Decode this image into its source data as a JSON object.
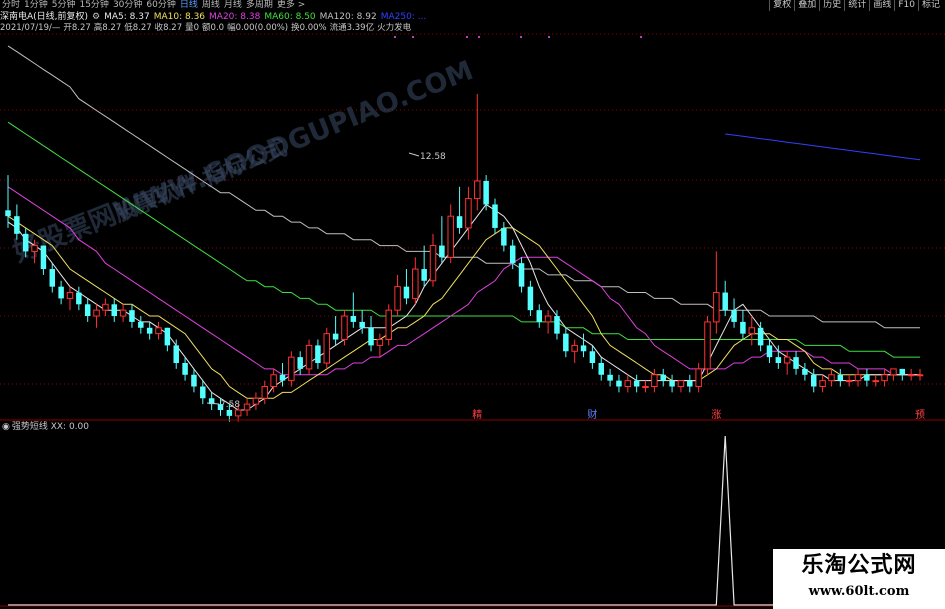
{
  "toolbar": {
    "periods": [
      "分时",
      "1分钟",
      "5分钟",
      "15分钟",
      "30分钟",
      "60分钟",
      "日线",
      "周线",
      "月线",
      "多周期",
      "更多 >"
    ],
    "active_period": "日线",
    "tools": [
      "复权",
      "叠加",
      "历史",
      "统计",
      "画线",
      "F10",
      "标记"
    ]
  },
  "stock": {
    "title": "深南电A(日线,前复权)",
    "ma": [
      {
        "label": "MA5: 8.37",
        "color": "#e8e8e8"
      },
      {
        "label": "MA10: 8.36",
        "color": "#f0e060"
      },
      {
        "label": "MA20: 8.38",
        "color": "#e040e0"
      },
      {
        "label": "MA60: 8.50",
        "color": "#40e040"
      },
      {
        "label": "MA120: 8.92",
        "color": "#c0c0c0"
      },
      {
        "label": "MA250: ...",
        "color": "#3040ff"
      }
    ],
    "ohlc": [
      "2021/07/19/—",
      "开8.27",
      "高8.27",
      "低8.27",
      "收8.27",
      "量0",
      "额0.0",
      "幅0.00(0.00%)",
      "换0.00%",
      "流通3.39亿",
      "火力发电"
    ]
  },
  "watermark": {
    "site": "好股票网WWW.GOODGUPIAO.COM",
    "tagline": "股票软件 指标公式"
  },
  "signals": [
    {
      "text": "精",
      "color": "#ff4040"
    },
    {
      "text": "财",
      "color": "#6080ff"
    },
    {
      "text": "涨",
      "color": "#ff4040"
    },
    {
      "text": "预",
      "color": "#ff4040"
    }
  ],
  "indicator": {
    "title": "强势短线 XX: 0.00"
  },
  "brand": {
    "name": "乐淘公式网",
    "url": "www.60lt.com"
  },
  "colors": {
    "up": "#ff3232",
    "down": "#54ffff",
    "grid": "#8b0000",
    "ma5": "#e8e8e8",
    "ma10": "#f0e060",
    "ma20": "#e040e0",
    "ma60": "#40e040",
    "ma120": "#c0c0c0",
    "ma250": "#3040ff"
  },
  "chart_data": [
    {
      "type": "candlestick",
      "title": "",
      "price_labels": {
        "high": "12.58",
        "low": "7.58"
      },
      "high_price": 12.58,
      "low_price": 7.58,
      "ylim": [
        7.2,
        13.5
      ],
      "candles": [
        [
          10.6,
          11.2,
          10.3,
          10.5
        ],
        [
          10.5,
          10.7,
          10.1,
          10.2
        ],
        [
          10.2,
          10.3,
          9.8,
          9.9
        ],
        [
          9.9,
          10.1,
          9.7,
          10.0
        ],
        [
          10.0,
          10.0,
          9.5,
          9.6
        ],
        [
          9.6,
          9.7,
          9.2,
          9.3
        ],
        [
          9.3,
          9.4,
          9.0,
          9.1
        ],
        [
          9.1,
          9.3,
          8.9,
          9.2
        ],
        [
          9.2,
          9.3,
          8.9,
          9.0
        ],
        [
          9.0,
          9.1,
          8.7,
          8.8
        ],
        [
          8.8,
          9.0,
          8.6,
          8.9
        ],
        [
          8.9,
          9.1,
          8.8,
          9.0
        ],
        [
          9.0,
          9.1,
          8.7,
          8.8
        ],
        [
          8.8,
          9.0,
          8.7,
          8.9
        ],
        [
          8.9,
          9.0,
          8.6,
          8.7
        ],
        [
          8.7,
          8.8,
          8.5,
          8.6
        ],
        [
          8.6,
          8.7,
          8.4,
          8.5
        ],
        [
          8.5,
          8.7,
          8.4,
          8.6
        ],
        [
          8.6,
          8.6,
          8.2,
          8.3
        ],
        [
          8.3,
          8.4,
          7.9,
          8.0
        ],
        [
          8.0,
          8.1,
          7.7,
          7.8
        ],
        [
          7.8,
          7.9,
          7.5,
          7.6
        ],
        [
          7.6,
          7.7,
          7.3,
          7.4
        ],
        [
          7.4,
          7.5,
          7.2,
          7.3
        ],
        [
          7.3,
          7.4,
          7.1,
          7.2
        ],
        [
          7.2,
          7.3,
          7.0,
          7.1
        ],
        [
          7.1,
          7.3,
          7.0,
          7.2
        ],
        [
          7.2,
          7.4,
          7.1,
          7.3
        ],
        [
          7.3,
          7.5,
          7.2,
          7.4
        ],
        [
          7.4,
          7.7,
          7.3,
          7.6
        ],
        [
          7.6,
          7.9,
          7.5,
          7.8
        ],
        [
          7.8,
          8.0,
          7.6,
          7.7
        ],
        [
          7.7,
          8.2,
          7.6,
          8.1
        ],
        [
          8.1,
          8.2,
          7.8,
          7.9
        ],
        [
          7.9,
          8.4,
          7.8,
          8.3
        ],
        [
          8.3,
          8.4,
          7.9,
          8.0
        ],
        [
          8.0,
          8.6,
          7.9,
          8.5
        ],
        [
          8.5,
          8.8,
          8.3,
          8.4
        ],
        [
          8.4,
          8.9,
          8.3,
          8.8
        ],
        [
          8.8,
          9.2,
          8.6,
          8.7
        ],
        [
          8.7,
          8.9,
          8.5,
          8.6
        ],
        [
          8.6,
          8.8,
          8.2,
          8.3
        ],
        [
          8.3,
          8.5,
          8.1,
          8.4
        ],
        [
          8.4,
          9.0,
          8.3,
          8.9
        ],
        [
          8.9,
          9.5,
          8.8,
          9.3
        ],
        [
          9.3,
          9.6,
          9.0,
          9.1
        ],
        [
          9.1,
          9.8,
          9.0,
          9.6
        ],
        [
          9.6,
          10.0,
          9.3,
          9.4
        ],
        [
          9.4,
          10.2,
          9.3,
          10.0
        ],
        [
          10.0,
          10.5,
          9.7,
          9.8
        ],
        [
          9.8,
          10.7,
          9.7,
          10.5
        ],
        [
          10.5,
          11.0,
          10.2,
          10.3
        ],
        [
          10.3,
          11.0,
          10.1,
          10.8
        ],
        [
          10.8,
          12.58,
          10.6,
          11.1
        ],
        [
          11.1,
          11.2,
          10.6,
          10.7
        ],
        [
          10.7,
          10.8,
          10.2,
          10.3
        ],
        [
          10.3,
          10.4,
          9.9,
          10.0
        ],
        [
          10.0,
          10.1,
          9.6,
          9.7
        ],
        [
          9.7,
          9.8,
          9.2,
          9.3
        ],
        [
          9.3,
          9.4,
          8.8,
          8.9
        ],
        [
          8.9,
          9.0,
          8.6,
          8.7
        ],
        [
          8.7,
          8.9,
          8.5,
          8.8
        ],
        [
          8.8,
          8.9,
          8.4,
          8.5
        ],
        [
          8.5,
          8.6,
          8.1,
          8.2
        ],
        [
          8.2,
          8.4,
          8.0,
          8.3
        ],
        [
          8.3,
          8.5,
          8.1,
          8.2
        ],
        [
          8.2,
          8.3,
          7.9,
          8.0
        ],
        [
          8.0,
          8.1,
          7.7,
          7.8
        ],
        [
          7.8,
          7.9,
          7.6,
          7.7
        ],
        [
          7.7,
          7.8,
          7.5,
          7.6
        ],
        [
          7.6,
          7.8,
          7.5,
          7.7
        ],
        [
          7.7,
          7.8,
          7.5,
          7.6
        ],
        [
          7.6,
          7.7,
          7.5,
          7.6
        ],
        [
          7.6,
          7.9,
          7.5,
          7.8
        ],
        [
          7.8,
          7.9,
          7.6,
          7.7
        ],
        [
          7.7,
          7.8,
          7.5,
          7.6
        ],
        [
          7.6,
          7.7,
          7.5,
          7.7
        ],
        [
          7.7,
          7.8,
          7.5,
          7.6
        ],
        [
          7.6,
          8.0,
          7.5,
          7.9
        ],
        [
          7.9,
          8.8,
          7.8,
          8.7
        ],
        [
          8.7,
          9.9,
          8.5,
          9.2
        ],
        [
          9.2,
          9.4,
          8.8,
          8.9
        ],
        [
          8.9,
          9.1,
          8.6,
          8.7
        ],
        [
          8.7,
          8.9,
          8.4,
          8.5
        ],
        [
          8.5,
          8.8,
          8.3,
          8.6
        ],
        [
          8.6,
          8.7,
          8.2,
          8.3
        ],
        [
          8.3,
          8.4,
          8.0,
          8.1
        ],
        [
          8.1,
          8.3,
          7.9,
          8.0
        ],
        [
          8.0,
          8.2,
          7.8,
          8.1
        ],
        [
          8.1,
          8.2,
          7.8,
          7.9
        ],
        [
          7.9,
          8.0,
          7.7,
          7.8
        ],
        [
          7.8,
          7.9,
          7.5,
          7.6
        ],
        [
          7.6,
          7.8,
          7.5,
          7.7
        ],
        [
          7.7,
          7.9,
          7.6,
          7.8
        ],
        [
          7.8,
          7.9,
          7.6,
          7.7
        ],
        [
          7.7,
          7.8,
          7.6,
          7.7
        ],
        [
          7.7,
          7.9,
          7.6,
          7.8
        ],
        [
          7.8,
          7.9,
          7.6,
          7.7
        ],
        [
          7.7,
          7.8,
          7.6,
          7.7
        ],
        [
          7.7,
          7.9,
          7.6,
          7.8
        ],
        [
          7.8,
          7.9,
          7.7,
          7.9
        ],
        [
          7.9,
          7.9,
          7.7,
          7.8
        ],
        [
          7.8,
          7.9,
          7.7,
          7.8
        ],
        [
          7.8,
          7.9,
          7.7,
          7.8
        ]
      ],
      "ma5": [
        10.4,
        10.3,
        10.1,
        10.0,
        9.9,
        9.7,
        9.5,
        9.3,
        9.2,
        9.1,
        9.0,
        8.9,
        8.9,
        8.9,
        8.8,
        8.7,
        8.7,
        8.6,
        8.5,
        8.3,
        8.1,
        7.9,
        7.7,
        7.5,
        7.4,
        7.3,
        7.2,
        7.2,
        7.3,
        7.4,
        7.6,
        7.7,
        7.8,
        7.9,
        8.0,
        8.1,
        8.2,
        8.3,
        8.4,
        8.5,
        8.6,
        8.6,
        8.6,
        8.6,
        8.7,
        8.8,
        9.0,
        9.3,
        9.5,
        9.7,
        9.9,
        10.1,
        10.3,
        10.5,
        10.7,
        10.6,
        10.5,
        10.3,
        10.0,
        9.7,
        9.3,
        9.0,
        8.8,
        8.6,
        8.5,
        8.4,
        8.3,
        8.1,
        8.0,
        7.9,
        7.8,
        7.7,
        7.7,
        7.7,
        7.7,
        7.7,
        7.7,
        7.7,
        7.7,
        8.0,
        8.3,
        8.6,
        8.9,
        9.0,
        8.8,
        8.6,
        8.4,
        8.2,
        8.1,
        8.0,
        7.9,
        7.8,
        7.8,
        7.7,
        7.7,
        7.7,
        7.7,
        7.8,
        7.8,
        7.8,
        7.8,
        7.8,
        7.8,
        7.8
      ],
      "ma10": [
        10.5,
        10.4,
        10.3,
        10.2,
        10.1,
        10.0,
        9.8,
        9.6,
        9.5,
        9.4,
        9.3,
        9.2,
        9.1,
        9.0,
        9.0,
        8.9,
        8.8,
        8.8,
        8.7,
        8.6,
        8.5,
        8.3,
        8.1,
        7.9,
        7.8,
        7.6,
        7.5,
        7.4,
        7.4,
        7.4,
        7.4,
        7.5,
        7.5,
        7.6,
        7.7,
        7.8,
        7.9,
        8.0,
        8.1,
        8.2,
        8.3,
        8.4,
        8.4,
        8.5,
        8.6,
        8.6,
        8.7,
        8.8,
        9.0,
        9.1,
        9.3,
        9.5,
        9.7,
        9.9,
        10.1,
        10.2,
        10.3,
        10.3,
        10.2,
        10.1,
        10.0,
        9.8,
        9.6,
        9.4,
        9.2,
        9.0,
        8.8,
        8.5,
        8.3,
        8.2,
        8.1,
        8.0,
        7.9,
        7.8,
        7.8,
        7.7,
        7.7,
        7.7,
        7.7,
        7.8,
        7.9,
        8.1,
        8.3,
        8.4,
        8.5,
        8.5,
        8.5,
        8.4,
        8.4,
        8.3,
        8.2,
        8.0,
        7.9,
        7.9,
        7.8,
        7.8,
        7.8,
        7.8,
        7.8,
        7.8,
        7.8,
        7.8,
        7.8,
        7.8
      ],
      "ma20": [
        11.0,
        10.9,
        10.8,
        10.7,
        10.6,
        10.5,
        10.4,
        10.3,
        10.1,
        10.0,
        9.9,
        9.7,
        9.6,
        9.5,
        9.4,
        9.3,
        9.2,
        9.1,
        9.0,
        8.9,
        8.8,
        8.7,
        8.6,
        8.5,
        8.4,
        8.3,
        8.2,
        8.1,
        8.0,
        7.9,
        7.9,
        7.8,
        7.8,
        7.8,
        7.8,
        7.8,
        7.8,
        7.9,
        7.9,
        8.0,
        8.0,
        8.1,
        8.1,
        8.2,
        8.3,
        8.3,
        8.4,
        8.5,
        8.6,
        8.7,
        8.8,
        8.9,
        9.0,
        9.2,
        9.3,
        9.4,
        9.6,
        9.7,
        9.8,
        9.8,
        9.8,
        9.8,
        9.8,
        9.7,
        9.6,
        9.5,
        9.4,
        9.3,
        9.1,
        9.0,
        8.8,
        8.6,
        8.5,
        8.3,
        8.2,
        8.1,
        8.0,
        7.9,
        7.9,
        7.9,
        7.9,
        7.9,
        8.0,
        8.0,
        8.1,
        8.1,
        8.2,
        8.2,
        8.2,
        8.2,
        8.2,
        8.1,
        8.1,
        8.0,
        8.0,
        8.0,
        7.9,
        7.9,
        7.9,
        7.9,
        7.8,
        7.8,
        7.8,
        7.8
      ],
      "ma60": [
        12.1,
        12.0,
        11.9,
        11.8,
        11.7,
        11.6,
        11.5,
        11.4,
        11.3,
        11.2,
        11.1,
        11.0,
        10.9,
        10.8,
        10.7,
        10.6,
        10.5,
        10.4,
        10.3,
        10.2,
        10.1,
        10.0,
        9.9,
        9.8,
        9.7,
        9.6,
        9.5,
        9.4,
        9.4,
        9.3,
        9.3,
        9.2,
        9.2,
        9.1,
        9.1,
        9.0,
        9.0,
        8.9,
        8.9,
        8.9,
        8.9,
        8.9,
        8.8,
        8.8,
        8.8,
        8.8,
        8.8,
        8.8,
        8.8,
        8.8,
        8.8,
        8.8,
        8.8,
        8.8,
        8.8,
        8.8,
        8.8,
        8.8,
        8.7,
        8.7,
        8.7,
        8.7,
        8.7,
        8.6,
        8.6,
        8.6,
        8.5,
        8.5,
        8.5,
        8.5,
        8.4,
        8.4,
        8.4,
        8.4,
        8.4,
        8.4,
        8.4,
        8.4,
        8.4,
        8.4,
        8.4,
        8.4,
        8.4,
        8.4,
        8.4,
        8.4,
        8.4,
        8.4,
        8.4,
        8.4,
        8.3,
        8.3,
        8.3,
        8.3,
        8.3,
        8.2,
        8.2,
        8.2,
        8.2,
        8.2,
        8.1,
        8.1,
        8.1,
        8.1
      ],
      "ma120": [
        13.4,
        13.3,
        13.2,
        13.1,
        13.0,
        12.9,
        12.8,
        12.7,
        12.5,
        12.4,
        12.3,
        12.2,
        12.1,
        12.0,
        11.9,
        11.8,
        11.7,
        11.6,
        11.5,
        11.4,
        11.3,
        11.2,
        11.1,
        11.0,
        10.9,
        10.9,
        10.8,
        10.7,
        10.6,
        10.6,
        10.5,
        10.5,
        10.4,
        10.4,
        10.3,
        10.3,
        10.2,
        10.2,
        10.2,
        10.1,
        10.1,
        10.1,
        10.0,
        10.0,
        10.0,
        9.9,
        9.9,
        9.9,
        9.9,
        9.8,
        9.8,
        9.8,
        9.8,
        9.8,
        9.7,
        9.7,
        9.7,
        9.7,
        9.6,
        9.6,
        9.6,
        9.5,
        9.5,
        9.5,
        9.4,
        9.4,
        9.4,
        9.3,
        9.3,
        9.3,
        9.2,
        9.2,
        9.2,
        9.1,
        9.1,
        9.1,
        9.0,
        9.0,
        9.0,
        9.0,
        8.9,
        8.9,
        8.9,
        8.9,
        8.9,
        8.9,
        8.8,
        8.8,
        8.8,
        8.8,
        8.8,
        8.8,
        8.7,
        8.7,
        8.7,
        8.7,
        8.7,
        8.7,
        8.7,
        8.6,
        8.6,
        8.6,
        8.6,
        8.6
      ],
      "ma250_tail": [
        11.9,
        11.88,
        11.86,
        11.84,
        11.82,
        11.8,
        11.78,
        11.76,
        11.74,
        11.72,
        11.7,
        11.68,
        11.66,
        11.64,
        11.62,
        11.6,
        11.58,
        11.56,
        11.54,
        11.52,
        11.5,
        11.48,
        11.46
      ],
      "signal_positions": [
        53,
        66,
        80,
        108
      ]
    },
    {
      "type": "line",
      "title": "强势短线",
      "series": [
        {
          "name": "XX",
          "values": [
            0,
            0,
            0,
            0,
            0,
            0,
            0,
            0,
            0,
            0,
            0,
            0,
            0,
            0,
            0,
            0,
            0,
            0,
            0,
            0,
            0,
            0,
            0,
            0,
            0,
            0,
            0,
            0,
            0,
            0,
            0,
            0,
            0,
            0,
            0,
            0,
            0,
            0,
            0,
            0,
            0,
            0,
            0,
            0,
            0,
            0,
            0,
            0,
            0,
            0,
            0,
            0,
            0,
            0,
            0,
            0,
            0,
            0,
            0,
            0,
            0,
            0,
            0,
            0,
            0,
            0,
            0,
            0,
            0,
            0,
            0,
            0,
            0,
            0,
            0,
            0,
            0,
            0,
            0,
            0,
            0,
            1,
            0,
            0,
            0,
            0,
            0,
            0,
            0,
            0,
            0,
            0,
            0,
            0,
            0,
            0,
            0,
            0,
            0,
            0,
            0,
            0,
            0,
            0,
            0
          ]
        }
      ],
      "ylim": [
        0,
        1
      ]
    }
  ]
}
